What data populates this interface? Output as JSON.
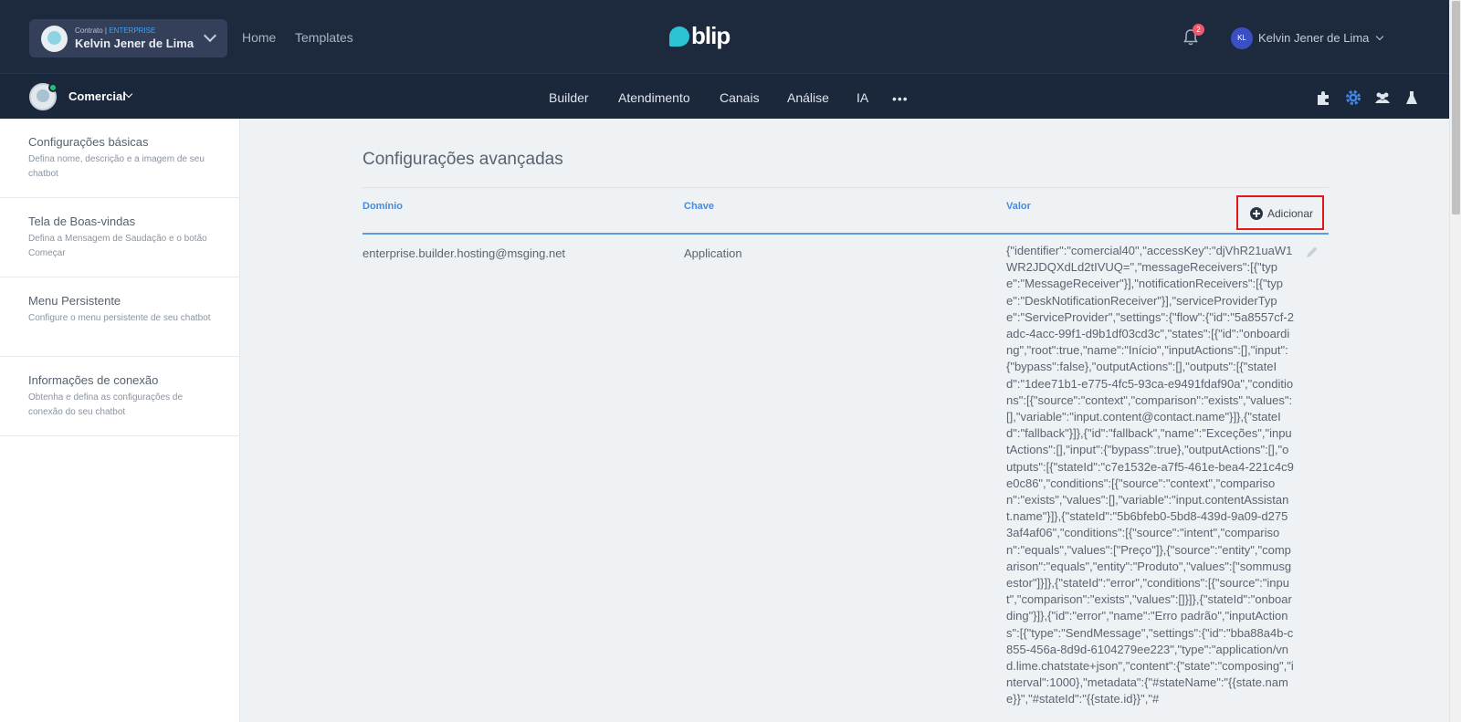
{
  "topbar": {
    "contract_label": "Contrato |",
    "contract_plan": "ENTERPRISE",
    "contract_name": "Kelvin Jener de Lima",
    "links": [
      "Home",
      "Templates"
    ],
    "logo_text": "blip",
    "notification_count": "2",
    "user_initials": "KL",
    "user_name": "Kelvin Jener de Lima"
  },
  "subbar": {
    "bot_name": "Comercial",
    "nav": [
      "Builder",
      "Atendimento",
      "Canais",
      "Análise",
      "IA"
    ],
    "more": "•••",
    "icons": [
      "puzzle-icon",
      "gear-icon",
      "team-icon",
      "flask-icon"
    ]
  },
  "sidebar": {
    "items": [
      {
        "title": "Configurações básicas",
        "desc": "Defina nome, descrição e a imagem de seu chatbot"
      },
      {
        "title": "Tela de Boas-vindas",
        "desc": "Defina a Mensagem de Saudação e o botão Começar"
      },
      {
        "title": "Menu Persistente",
        "desc": "Configure o menu persistente de seu chatbot"
      },
      {
        "title": "Informações de conexão",
        "desc": "Obtenha e defina as configurações de conexão do seu chatbot"
      }
    ]
  },
  "main": {
    "title": "Configurações avançadas",
    "columns": [
      "Domínio",
      "Chave",
      "Valor"
    ],
    "add_label": "Adicionar",
    "rows": [
      {
        "domain": "enterprise.builder.hosting@msging.net",
        "key": "Application",
        "value": "{\"identifier\":\"comercial40\",\"accessKey\":\"djVhR21uaW1WR2JDQXdLd2tIVUQ=\",\"messageReceivers\":[{\"type\":\"MessageReceiver\"}],\"notificationReceivers\":[{\"type\":\"DeskNotificationReceiver\"}],\"serviceProviderType\":\"ServiceProvider\",\"settings\":{\"flow\":{\"id\":\"5a8557cf-2adc-4acc-99f1-d9b1df03cd3c\",\"states\":[{\"id\":\"onboarding\",\"root\":true,\"name\":\"Início\",\"inputActions\":[],\"input\":{\"bypass\":false},\"outputActions\":[],\"outputs\":[{\"stateId\":\"1dee71b1-e775-4fc5-93ca-e9491fdaf90a\",\"conditions\":[{\"source\":\"context\",\"comparison\":\"exists\",\"values\":[],\"variable\":\"input.content@contact.name\"}]},{\"stateId\":\"fallback\"}]},{\"id\":\"fallback\",\"name\":\"Exceções\",\"inputActions\":[],\"input\":{\"bypass\":true},\"outputActions\":[],\"outputs\":[{\"stateId\":\"c7e1532e-a7f5-461e-bea4-221c4c9e0c86\",\"conditions\":[{\"source\":\"context\",\"comparison\":\"exists\",\"values\":[],\"variable\":\"input.contentAssistant.name\"}]},{\"stateId\":\"5b6bfeb0-5bd8-439d-9a09-d2753af4af06\",\"conditions\":[{\"source\":\"intent\",\"comparison\":\"equals\",\"values\":[\"Preço\"]},{\"source\":\"entity\",\"comparison\":\"equals\",\"entity\":\"Produto\",\"values\":[\"sommusgestor\"]}]},{\"stateId\":\"error\",\"conditions\":[{\"source\":\"input\",\"comparison\":\"exists\",\"values\":[]}]},{\"stateId\":\"onboarding\"}]},{\"id\":\"error\",\"name\":\"Erro padrão\",\"inputActions\":[{\"type\":\"SendMessage\",\"settings\":{\"id\":\"bba88a4b-c855-456a-8d9d-6104279ee223\",\"type\":\"application/vnd.lime.chatstate+json\",\"content\":{\"state\":\"composing\",\"interval\":1000},\"metadata\":{\"#stateName\":\"{{state.name}}\",\"#stateId\":\"{{state.id}}\",\"#"
      }
    ]
  },
  "colors": {
    "topbar": "#1d2a3e",
    "subbar": "#1b283b",
    "accent_blue": "#4a8bd9",
    "highlight_red": "#e11a1a",
    "online_green": "#21c56f"
  }
}
